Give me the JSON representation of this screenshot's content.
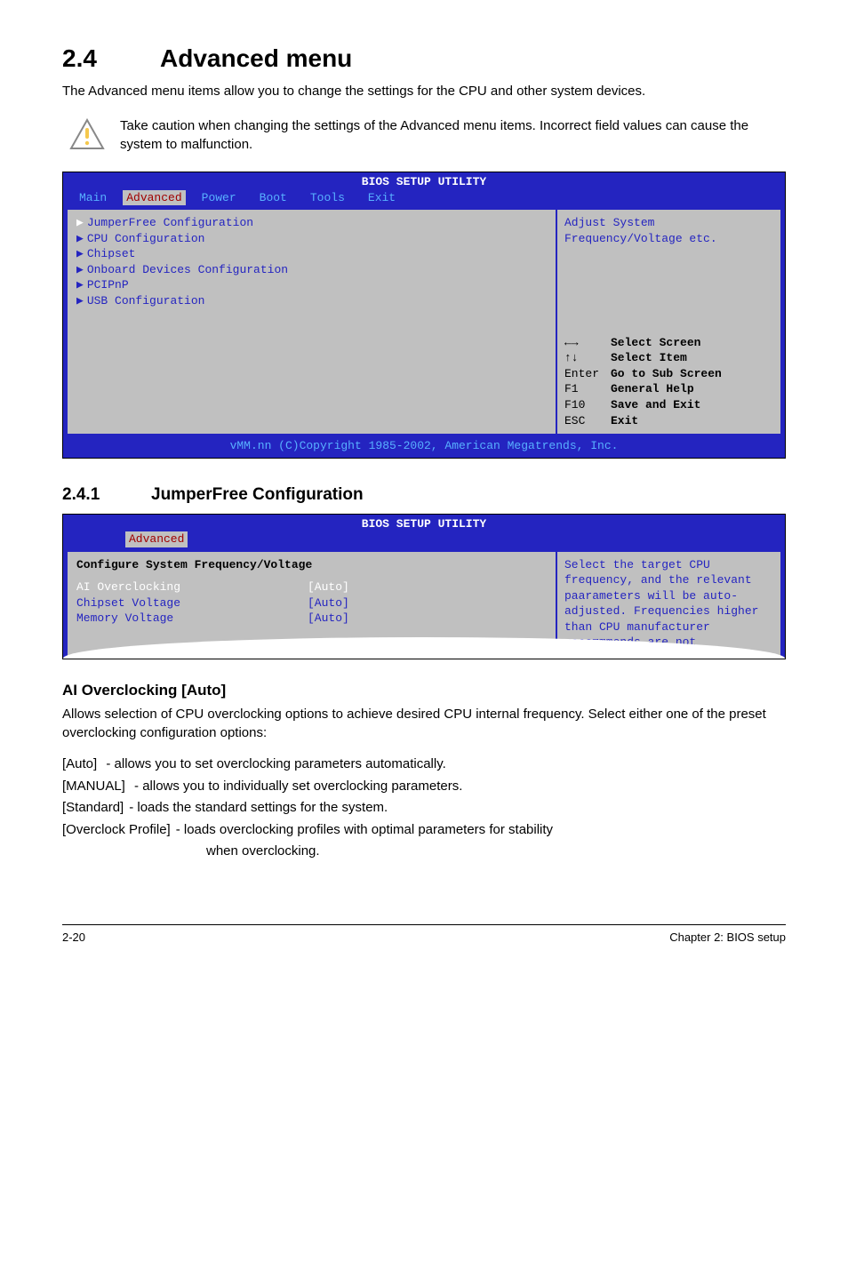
{
  "section": {
    "number": "2.4",
    "title": "Advanced menu"
  },
  "intro": "The Advanced menu items allow you to change the settings for the CPU and other system devices.",
  "note": "Take caution when changing the settings of the Advanced menu items. Incorrect field values can cause the system to malfunction.",
  "bios1": {
    "title": "BIOS SETUP UTILITY",
    "tabs": [
      "Main",
      "Advanced",
      "Power",
      "Boot",
      "Tools",
      "Exit"
    ],
    "active_tab": "Advanced",
    "menu": [
      "JumperFree Configuration",
      "CPU Configuration",
      "Chipset",
      "Onboard Devices Configuration",
      "PCIPnP",
      "USB Configuration"
    ],
    "help_desc": "Adjust System Frequency/Voltage etc.",
    "help_keys": [
      {
        "k": "←→",
        "a": "Select Screen"
      },
      {
        "k": "↑↓",
        "a": "Select Item"
      },
      {
        "k": "Enter",
        "a": "Go to Sub Screen"
      },
      {
        "k": "F1",
        "a": "General Help"
      },
      {
        "k": "F10",
        "a": "Save and Exit"
      },
      {
        "k": "ESC",
        "a": "Exit"
      }
    ],
    "footer": "vMM.nn (C)Copyright 1985-2002, American Megatrends, Inc."
  },
  "subsection": {
    "number": "2.4.1",
    "title": "JumperFree Configuration"
  },
  "bios2": {
    "title": "BIOS SETUP UTILITY",
    "tab": "Advanced",
    "header": "Configure System Frequency/Voltage",
    "rows": [
      {
        "label": "AI Overclocking",
        "value": "[Auto]",
        "hl": true
      },
      {
        "label": "Chipset Voltage",
        "value": "[Auto]",
        "hl": false
      },
      {
        "label": "Memory Voltage",
        "value": "[Auto]",
        "hl": false
      }
    ],
    "help_desc": "Select the target CPU frequency, and the relevant paarameters will be auto-adjusted. Frequencies higher than CPU manufacturer recommmends are not"
  },
  "ai_heading": "AI Overclocking [Auto]",
  "ai_body": "Allows selection of CPU overclocking options to achieve desired CPU internal frequency. Select either one of the preset overclocking configuration options:",
  "options": [
    {
      "term": "[Auto]",
      "desc": "- allows you to set overclocking parameters automatically."
    },
    {
      "term": "[MANUAL]",
      "desc": "- allows you to individually set overclocking parameters."
    },
    {
      "term": "[Standard]",
      "desc": "- loads the standard settings for the system."
    },
    {
      "term": "[Overclock Profile]",
      "desc": "- loads overclocking profiles with optimal parameters for stability"
    }
  ],
  "option_cont": "when overclocking.",
  "footer": {
    "left": "2-20",
    "right": "Chapter 2: BIOS setup"
  }
}
